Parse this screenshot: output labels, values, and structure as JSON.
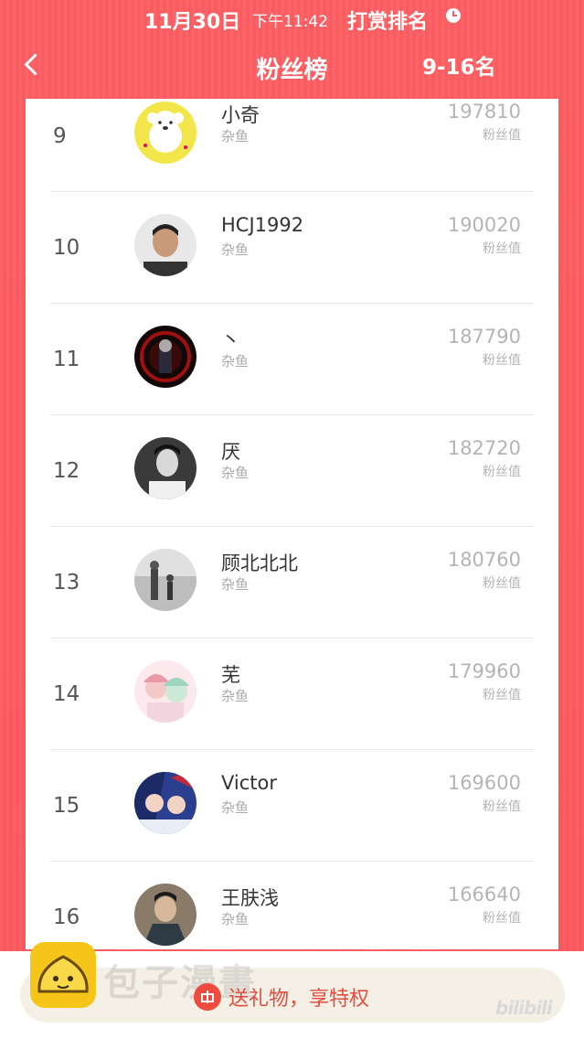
{
  "status_bar": {
    "date": "11月30日",
    "time": "下午11:42",
    "title": "打赏排名"
  },
  "nav": {
    "title": "粉丝榜",
    "range": "9-16名"
  },
  "rows": [
    {
      "rank": "9",
      "name": "小奇",
      "level": "杂鱼",
      "score": "197810",
      "score_label": "粉丝值"
    },
    {
      "rank": "10",
      "name": "HCJ1992",
      "level": "杂鱼",
      "score": "190020",
      "score_label": "粉丝值"
    },
    {
      "rank": "11",
      "name": "丶",
      "level": "杂鱼",
      "score": "187790",
      "score_label": "粉丝值"
    },
    {
      "rank": "12",
      "name": "厌",
      "level": "杂鱼",
      "score": "182720",
      "score_label": "粉丝值"
    },
    {
      "rank": "13",
      "name": "顾北北北",
      "level": "杂鱼",
      "score": "180760",
      "score_label": "粉丝值"
    },
    {
      "rank": "14",
      "name": "芜",
      "level": "杂鱼",
      "score": "179960",
      "score_label": "粉丝值"
    },
    {
      "rank": "15",
      "name": "Victor",
      "level": "杂鱼",
      "score": "169600",
      "score_label": "粉丝值"
    },
    {
      "rank": "16",
      "name": "王肤浅",
      "level": "杂鱼",
      "score": "166640",
      "score_label": "粉丝值"
    }
  ],
  "bottom": {
    "gift_label": "送礼物，享特权",
    "watermark": "包子漫畫",
    "logo_mark": "bilibili"
  },
  "colors": {
    "theme": "#f85a5e",
    "gift": "#ef4a3e"
  }
}
